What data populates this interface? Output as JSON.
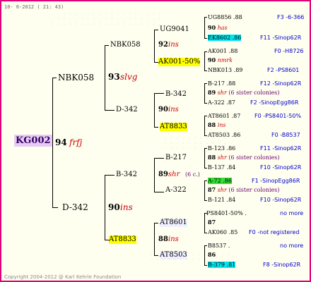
{
  "header": {
    "date": "10-  6-2012 ( 21: 43)"
  },
  "footer": {
    "copyright": "Copyright 2004-2012 @ Karl Kehrle Foundation"
  },
  "root": {
    "id": "KG002",
    "score": "94",
    "note": "frfj"
  },
  "gen1": {
    "father": {
      "id": "NBK058",
      "score": "93",
      "note": "slvg"
    },
    "mother": {
      "id": "D-342",
      "score": "90",
      "note": "ins"
    }
  },
  "gen2": [
    {
      "id": "NBK058",
      "score": "92",
      "note": "ins"
    },
    {
      "id": "D-342",
      "score": "90",
      "note": "ins"
    },
    {
      "id": "B-342",
      "score": "89",
      "note": "shr",
      "extra": "(6 c.)"
    },
    {
      "id": "AT8833",
      "score": "88",
      "note": "ins"
    }
  ],
  "gen3": [
    {
      "id": "UG9041",
      "score": "90",
      "note": "has"
    },
    {
      "id": "AK001-50%",
      "score": "90",
      "note": "nmrk"
    },
    {
      "id": "B-342",
      "score": "89",
      "note": "shr",
      "extra": "(6 sister colonies)"
    },
    {
      "id": "AT8833",
      "score": "88",
      "note": "ins"
    },
    {
      "id": "B-217",
      "score": "88",
      "note": "shr",
      "extra": "(6 sister colonies)"
    },
    {
      "id": "A-322",
      "score": "87",
      "note": "shr",
      "extra": "(6 sister colonies)"
    },
    {
      "id": "AT8601",
      "score": "87",
      "note": ""
    },
    {
      "id": "AT8503",
      "score": "86",
      "note": ""
    }
  ],
  "gen4": [
    {
      "id": "UG8856",
      "score": ".88",
      "origin": "F3 -6-366"
    },
    {
      "id": "EK8602",
      "score": ".86",
      "origin": "F11 -Sinop62R"
    },
    {
      "id": "AK001",
      "score": ".88",
      "origin": "F0 -H8726"
    },
    {
      "id": "NBK013",
      "score": ".89",
      "origin": "F2 -PS8601"
    },
    {
      "id": "B-217",
      "score": ".88",
      "origin": "F12 -Sinop62R"
    },
    {
      "id": "A-322",
      "score": ".87",
      "origin": "F2 -SinopEgg86R"
    },
    {
      "id": "AT8601",
      "score": ".87",
      "origin": "F0 -PS8401-50%"
    },
    {
      "id": "AT8503",
      "score": ".86",
      "origin": "F0 -B8537"
    },
    {
      "id": "B-123",
      "score": ".86",
      "origin": "F11 -Sinop62R"
    },
    {
      "id": "B-137",
      "score": ".84",
      "origin": "F10 -Sinop62R"
    },
    {
      "id": "A-72",
      "score": ".86",
      "origin": "F1 -SinopEgg86R"
    },
    {
      "id": "B-121",
      "score": ".84",
      "origin": "F10 -Sinop62R"
    },
    {
      "id": "PS8401-50%",
      "score": ".",
      "origin": "no more"
    },
    {
      "id": "AK060",
      "score": ".85",
      "origin": "F0 -not registered"
    },
    {
      "id": "B8537",
      "score": ".",
      "origin": "no more"
    },
    {
      "id": "B-379",
      "score": ".81",
      "origin": "F8 -Sinop62R"
    }
  ]
}
